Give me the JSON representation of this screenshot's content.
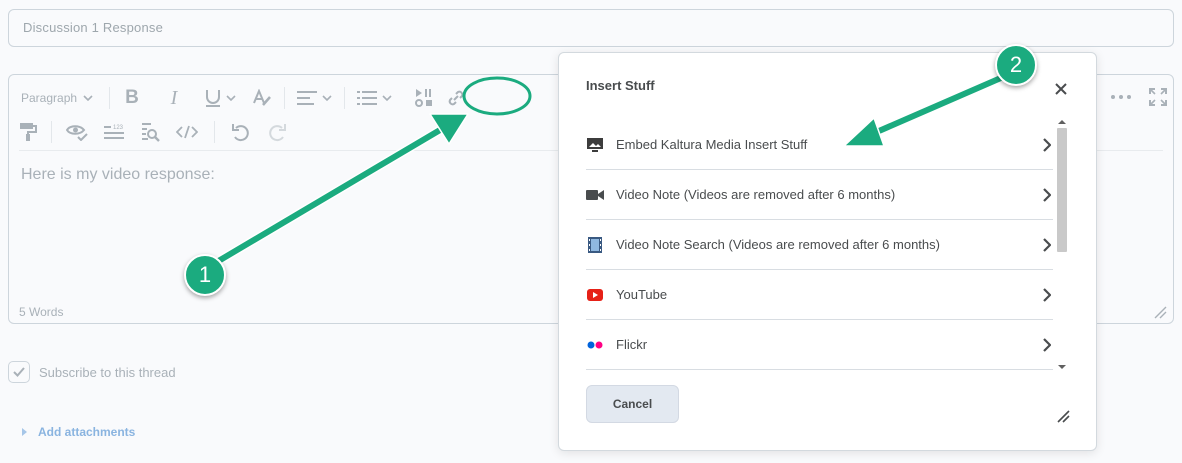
{
  "form": {
    "title_placeholder": "Discussion 1 Response",
    "subscribe_label": "Subscribe to this thread",
    "attachments_label": "Add attachments"
  },
  "editor": {
    "paragraph_label": "Paragraph",
    "content": "Here is my video response:",
    "word_count": "5 Words"
  },
  "dialog": {
    "title": "Insert Stuff",
    "items": [
      {
        "label": "Embed Kaltura Media Insert Stuff",
        "icon": "monitor-image-icon"
      },
      {
        "label": "Video Note (Videos are removed after 6 months)",
        "icon": "video-camera-icon"
      },
      {
        "label": "Video Note Search (Videos are removed after 6 months)",
        "icon": "film-strip-icon"
      },
      {
        "label": "YouTube",
        "icon": "youtube-icon"
      },
      {
        "label": "Flickr",
        "icon": "flickr-icon"
      }
    ],
    "cancel_label": "Cancel"
  },
  "annotations": {
    "badge1": "1",
    "badge2": "2",
    "accent_color": "#1bab7f"
  }
}
